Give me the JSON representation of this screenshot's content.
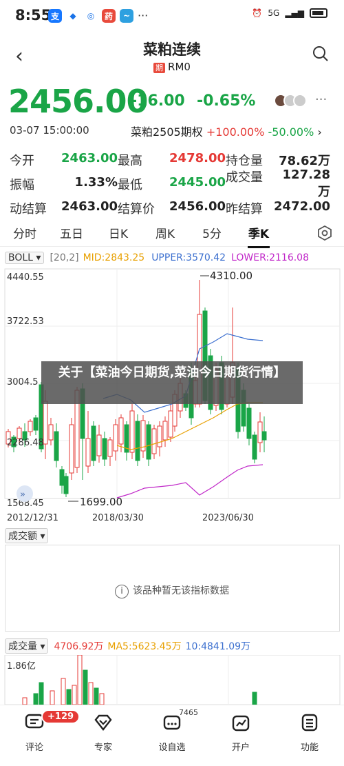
{
  "status": {
    "time": "8:55",
    "apps": [
      "支",
      "◆",
      "◎",
      "药",
      "~"
    ],
    "signal": "5G"
  },
  "nav": {
    "title": "菜粕连续",
    "sub_tag": "期",
    "sub": "RM0"
  },
  "quote": {
    "price": "2456.00",
    "change": "-16.00",
    "change_pct": "-0.65%",
    "datetime": "03-07 15:00:00",
    "contract": "菜粕2505期权",
    "contract_up": "+100.00%",
    "contract_dn": "-50.00%"
  },
  "stats": [
    [
      {
        "l": "今开",
        "v": "2463.00",
        "c": "green"
      },
      {
        "l": "最高",
        "v": "2478.00",
        "c": "red"
      },
      {
        "l": "持仓量",
        "v": "78.62万",
        "c": ""
      }
    ],
    [
      {
        "l": "振幅",
        "v": "1.33%",
        "c": ""
      },
      {
        "l": "最低",
        "v": "2445.00",
        "c": "green"
      },
      {
        "l": "成交量",
        "v": "127.28万",
        "c": ""
      }
    ],
    [
      {
        "l": "动结算",
        "v": "2463.00",
        "c": ""
      },
      {
        "l": "结算价",
        "v": "2456.00",
        "c": ""
      },
      {
        "l": "昨结算",
        "v": "2472.00",
        "c": ""
      }
    ]
  ],
  "tabs": [
    "分时",
    "五日",
    "日K",
    "周K",
    "5分",
    "季K"
  ],
  "indicator": {
    "name": "BOLL",
    "params": "[20,2]",
    "mid": "MID:2843.25",
    "upper": "UPPER:3570.42",
    "lower": "LOWER:2116.08"
  },
  "kchart": {
    "y_labels": [
      "4440.55",
      "3722.53",
      "3004.5",
      "2286.48",
      "1568.45"
    ],
    "x_labels": [
      "2012/12/31",
      "2018/03/30",
      "2023/06/30"
    ],
    "high_label": "4310.00",
    "low_label": "1699.00"
  },
  "overlay_text": "关于【菜油今日期货,菜油今日期货行情】",
  "sub1": {
    "name": "成交额",
    "nodata": "该品种暂无该指标数据"
  },
  "volume": {
    "name": "成交量",
    "v1": "4706.92万",
    "v2": "MA5:5623.45万",
    "v3": "10:4841.09万",
    "y_label": "1.86亿"
  },
  "bottom_nav": [
    {
      "label": "评论",
      "badge": "+129"
    },
    {
      "label": "专家",
      "badge": ""
    },
    {
      "label": "设自选",
      "badge": "7465"
    },
    {
      "label": "开户",
      "badge": ""
    },
    {
      "label": "功能",
      "badge": ""
    }
  ],
  "colors": {
    "up": "#e53935",
    "down": "#1aa547",
    "mid": "#e8a000",
    "upper": "#3b6fcf",
    "lower": "#c026c8"
  }
}
